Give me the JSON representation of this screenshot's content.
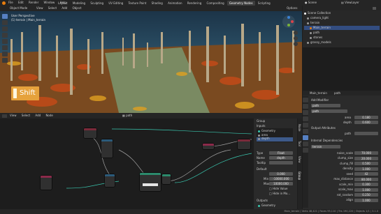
{
  "topbar": {
    "menus": [
      "File",
      "Edit",
      "Render",
      "Window",
      "Help"
    ],
    "workspaces": [
      "Layout",
      "Modeling",
      "Sculpting",
      "UV Editing",
      "Texture Paint",
      "Shading",
      "Animation",
      "Rendering",
      "Compositing",
      "Geometry Nodes",
      "Scripting"
    ],
    "active_workspace": "Geometry Nodes",
    "scene_label": "Scene",
    "viewlayer_label": "ViewLayer"
  },
  "viewport": {
    "mode": "Object Mode",
    "menus": [
      "View",
      "Select",
      "Add",
      "Object"
    ],
    "info_line1": "User Perspective",
    "info_line2": "(1) terrain | Main_terrain",
    "shift_label": "Shift",
    "options_label": "Options"
  },
  "node_editor": {
    "menus": [
      "View",
      "Select",
      "Add",
      "Node"
    ],
    "breadcrumb_object": "Main_terrain",
    "breadcrumb_modifier": "path",
    "tree_name": "path",
    "side_panel": {
      "group_label": "Group",
      "sockets_header": "Inputs",
      "sockets": [
        "Geometry",
        "area",
        "depth"
      ],
      "type_label": "Type",
      "type_value": "Float",
      "name_label": "Name",
      "name_value": "depth",
      "tooltip_label": "Tooltip",
      "default_label": "Default",
      "default_value": "0.000",
      "min_label": "Min",
      "min_value": "-10000.000",
      "max_label": "Max",
      "max_value": "10000.000",
      "hide_value_label": "Hide Value",
      "hide_modifier_label": "Hide in Mo...",
      "outputs_header": "Outputs",
      "output_socket": "Geometry"
    },
    "tabs": [
      "Node",
      "Tool",
      "View",
      "Group"
    ]
  },
  "outliner": {
    "title": "Scene Collection",
    "items": [
      {
        "label": "camera_light",
        "level": 1
      },
      {
        "label": "terrain",
        "level": 1
      },
      {
        "label": "Main_terrain",
        "level": 2
      },
      {
        "label": "path",
        "level": 2
      },
      {
        "label": "stones",
        "level": 2
      },
      {
        "label": "grassy_models",
        "level": 1
      }
    ]
  },
  "properties": {
    "object_label": "Main_terrain",
    "modifier_label": "path",
    "add_modifier": "Add Modifier",
    "modifier_name": "path",
    "geonode_tree": "path",
    "area_label": "area",
    "area_value": "0.180",
    "depth_label": "depth",
    "depth_value": "0.600",
    "output_attributes": "Output Attributes",
    "path_label": "path",
    "instanced_header": "Internal Dependencies",
    "scatter_name": "terrain",
    "rows": [
      {
        "label": "noise_scale",
        "value": "70.000"
      },
      {
        "label": "clump_size",
        "value": "20.000"
      },
      {
        "label": "clump_fill",
        "value": "0.500"
      },
      {
        "label": "density",
        "value": "1.000"
      },
      {
        "label": "seed",
        "value": "42"
      },
      {
        "label": "max_distance",
        "value": "80.000"
      },
      {
        "label": "scale_min",
        "value": "0.300"
      },
      {
        "label": "scale_max",
        "value": "1.000"
      },
      {
        "label": "rot_random",
        "value": "0.250"
      },
      {
        "label": "align",
        "value": "1.000"
      }
    ]
  },
  "statusbar": {
    "left": "",
    "right": "Main_terrain | Verts 48,421 | Faces 95,110 | Tris 190,220 | Objects 1/1 | 3.1.0",
    "version": "3.1.0"
  },
  "colors": {
    "accent": "#5680c2",
    "header_geo": "#2c8a6c",
    "header_input": "#8b2a4a",
    "header_math": "#2b5a7a",
    "header_group": "#3a6a3a",
    "shift_badge": "#e6a23c",
    "active_tab": "#3d3d3d"
  }
}
